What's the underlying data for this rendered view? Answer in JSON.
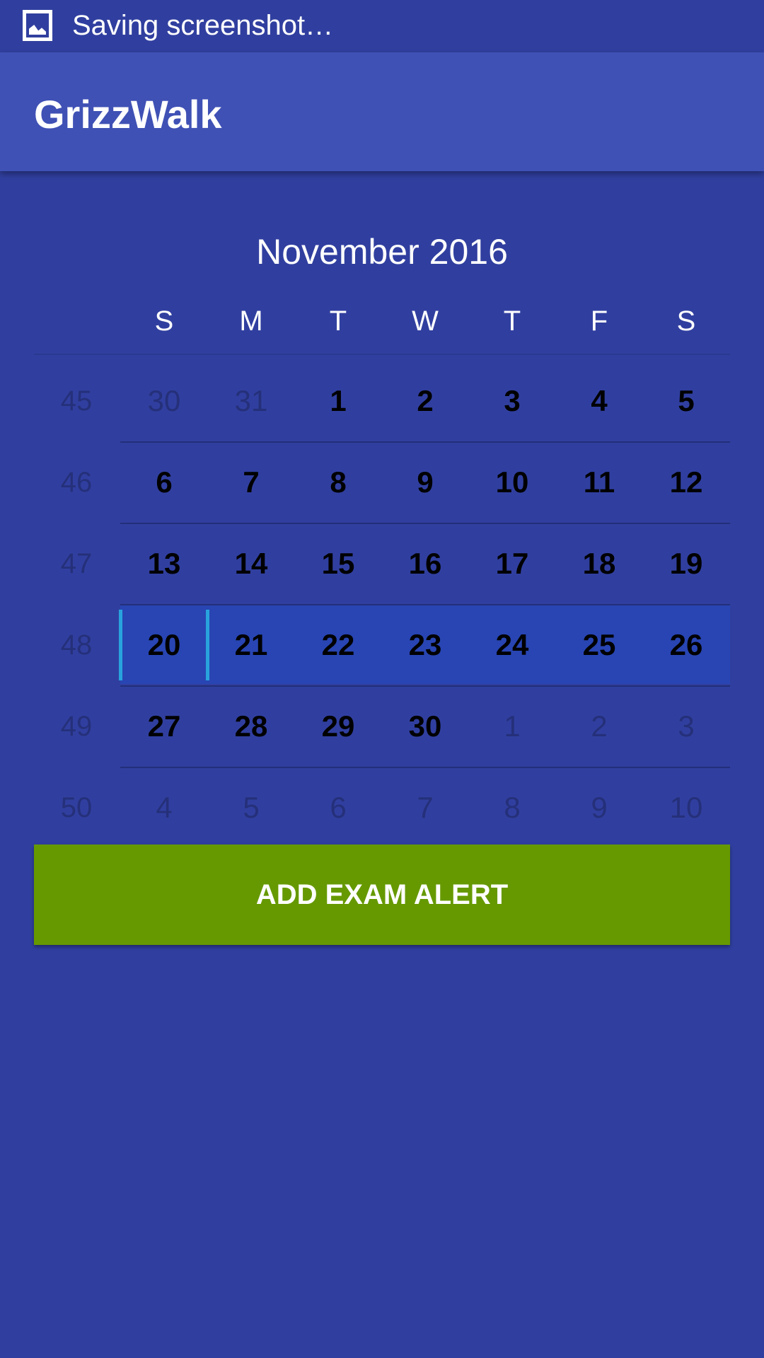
{
  "status_bar": {
    "text": "Saving screenshot…",
    "icon": "screenshot-image-icon"
  },
  "app_bar": {
    "title": "GrizzWalk"
  },
  "calendar": {
    "month_title": "November 2016",
    "weekdays": [
      "S",
      "M",
      "T",
      "W",
      "T",
      "F",
      "S"
    ],
    "selected_week": 48,
    "weeks": [
      {
        "number": "45",
        "days": [
          {
            "label": "30",
            "in_month": false
          },
          {
            "label": "31",
            "in_month": false
          },
          {
            "label": "1",
            "in_month": true
          },
          {
            "label": "2",
            "in_month": true
          },
          {
            "label": "3",
            "in_month": true
          },
          {
            "label": "4",
            "in_month": true
          },
          {
            "label": "5",
            "in_month": true
          }
        ]
      },
      {
        "number": "46",
        "days": [
          {
            "label": "6",
            "in_month": true
          },
          {
            "label": "7",
            "in_month": true
          },
          {
            "label": "8",
            "in_month": true
          },
          {
            "label": "9",
            "in_month": true
          },
          {
            "label": "10",
            "in_month": true
          },
          {
            "label": "11",
            "in_month": true
          },
          {
            "label": "12",
            "in_month": true
          }
        ]
      },
      {
        "number": "47",
        "days": [
          {
            "label": "13",
            "in_month": true
          },
          {
            "label": "14",
            "in_month": true
          },
          {
            "label": "15",
            "in_month": true
          },
          {
            "label": "16",
            "in_month": true
          },
          {
            "label": "17",
            "in_month": true
          },
          {
            "label": "18",
            "in_month": true
          },
          {
            "label": "19",
            "in_month": true
          }
        ]
      },
      {
        "number": "48",
        "days": [
          {
            "label": "20",
            "in_month": true
          },
          {
            "label": "21",
            "in_month": true
          },
          {
            "label": "22",
            "in_month": true
          },
          {
            "label": "23",
            "in_month": true
          },
          {
            "label": "24",
            "in_month": true
          },
          {
            "label": "25",
            "in_month": true
          },
          {
            "label": "26",
            "in_month": true
          }
        ]
      },
      {
        "number": "49",
        "days": [
          {
            "label": "27",
            "in_month": true
          },
          {
            "label": "28",
            "in_month": true
          },
          {
            "label": "29",
            "in_month": true
          },
          {
            "label": "30",
            "in_month": true
          },
          {
            "label": "1",
            "in_month": false
          },
          {
            "label": "2",
            "in_month": false
          },
          {
            "label": "3",
            "in_month": false
          }
        ]
      },
      {
        "number": "50",
        "days": [
          {
            "label": "4",
            "in_month": false
          },
          {
            "label": "5",
            "in_month": false
          },
          {
            "label": "6",
            "in_month": false
          },
          {
            "label": "7",
            "in_month": false
          },
          {
            "label": "8",
            "in_month": false
          },
          {
            "label": "9",
            "in_month": false
          },
          {
            "label": "10",
            "in_month": false
          }
        ]
      }
    ]
  },
  "actions": {
    "add_exam_alert_label": "ADD EXAM ALERT"
  },
  "colors": {
    "background": "#303F9F",
    "app_bar": "#3F51B5",
    "selected_week": "#2845B3",
    "selection_marker": "#29A3DD",
    "button": "#669900"
  }
}
